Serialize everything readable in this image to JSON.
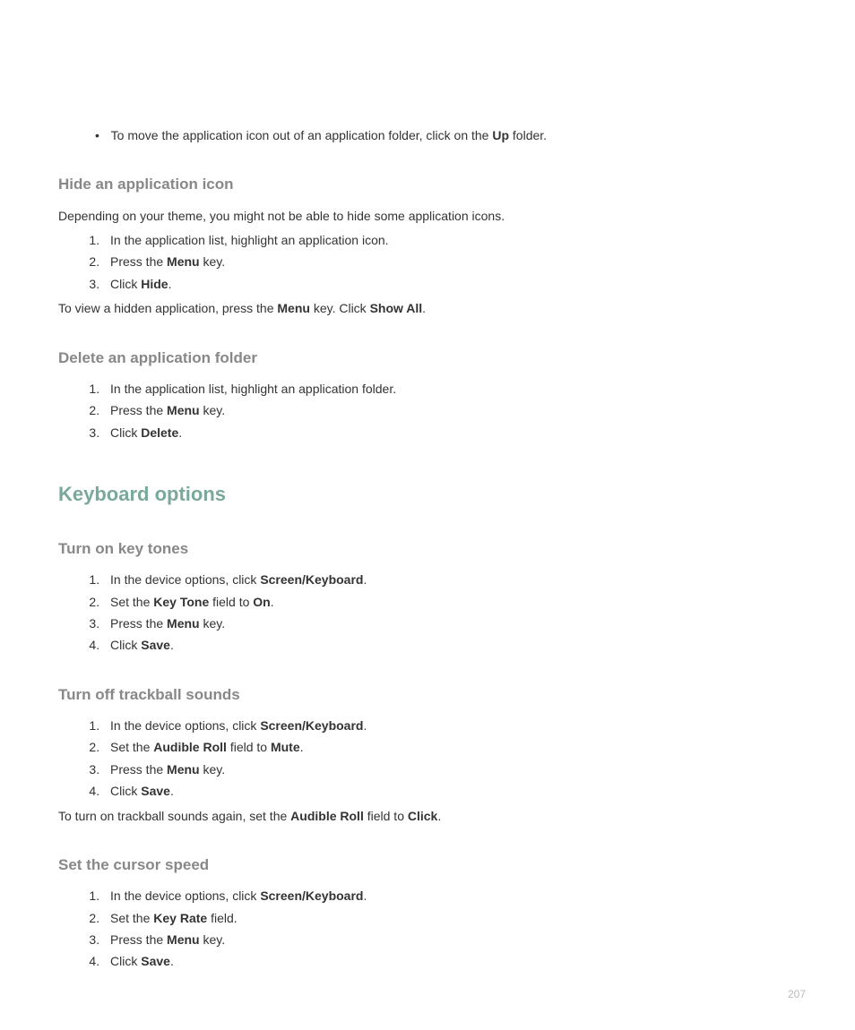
{
  "top_bullet": {
    "prefix": "To move the application icon out of an application folder, click on the ",
    "bold": "Up",
    "suffix": " folder."
  },
  "hide_section": {
    "heading": "Hide an application icon",
    "intro": "Depending on your theme, you might not be able to hide some application icons.",
    "steps": [
      {
        "prefix": "In the application list, highlight an application icon.",
        "bold": "",
        "suffix": ""
      },
      {
        "prefix": "Press the ",
        "bold": "Menu",
        "suffix": " key."
      },
      {
        "prefix": "Click ",
        "bold": "Hide",
        "suffix": "."
      }
    ],
    "note": {
      "p1": "To view a hidden application, press the ",
      "b1": "Menu",
      "p2": " key. Click ",
      "b2": "Show All",
      "p3": "."
    }
  },
  "delete_section": {
    "heading": "Delete an application folder",
    "steps": [
      {
        "prefix": "In the application list, highlight an application folder.",
        "bold": "",
        "suffix": ""
      },
      {
        "prefix": "Press the ",
        "bold": "Menu",
        "suffix": " key."
      },
      {
        "prefix": "Click ",
        "bold": "Delete",
        "suffix": "."
      }
    ]
  },
  "keyboard_heading": "Keyboard options",
  "keytones_section": {
    "heading": "Turn on key tones",
    "steps": [
      {
        "prefix": "In the device options, click ",
        "bold": "Screen/Keyboard",
        "suffix": "."
      },
      {
        "prefix": "Set the ",
        "bold": "Key Tone",
        "mid": " field to ",
        "bold2": "On",
        "suffix": "."
      },
      {
        "prefix": "Press the ",
        "bold": "Menu",
        "suffix": " key."
      },
      {
        "prefix": "Click ",
        "bold": "Save",
        "suffix": "."
      }
    ]
  },
  "trackball_section": {
    "heading": "Turn off trackball sounds",
    "steps": [
      {
        "prefix": "In the device options, click ",
        "bold": "Screen/Keyboard",
        "suffix": "."
      },
      {
        "prefix": "Set the ",
        "bold": "Audible Roll",
        "mid": " field to ",
        "bold2": "Mute",
        "suffix": "."
      },
      {
        "prefix": "Press the ",
        "bold": "Menu",
        "suffix": " key."
      },
      {
        "prefix": "Click ",
        "bold": "Save",
        "suffix": "."
      }
    ],
    "note": {
      "p1": "To turn on trackball sounds again, set the ",
      "b1": "Audible Roll",
      "p2": " field to ",
      "b2": "Click",
      "p3": "."
    }
  },
  "cursor_section": {
    "heading": "Set the cursor speed",
    "steps": [
      {
        "prefix": "In the device options, click ",
        "bold": "Screen/Keyboard",
        "suffix": "."
      },
      {
        "prefix": "Set the ",
        "bold": "Key Rate",
        "suffix": " field."
      },
      {
        "prefix": "Press the ",
        "bold": "Menu",
        "suffix": " key."
      },
      {
        "prefix": "Click ",
        "bold": "Save",
        "suffix": "."
      }
    ]
  },
  "page_number": "207"
}
